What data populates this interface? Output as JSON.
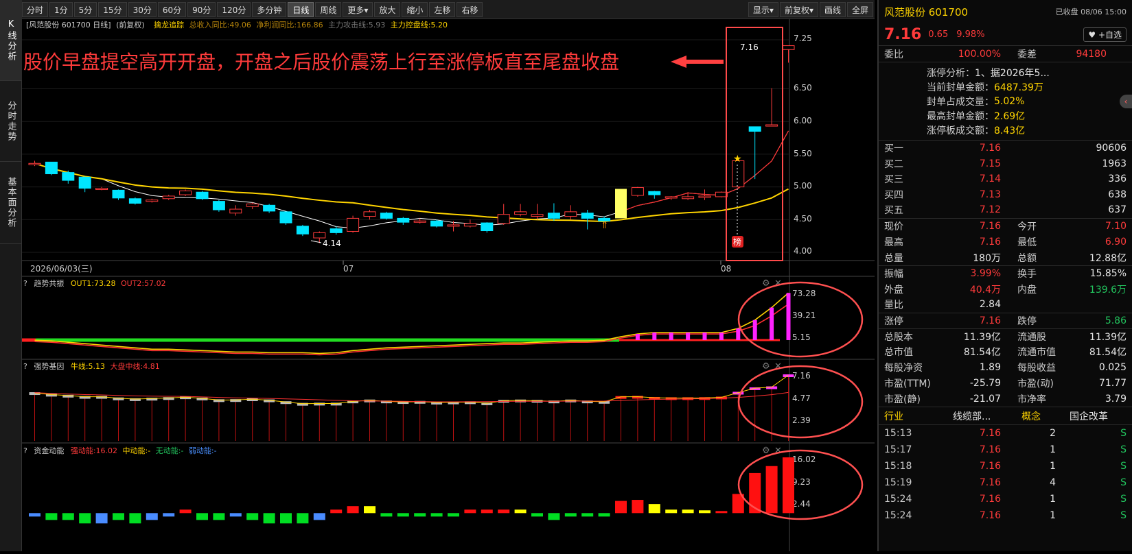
{
  "left_tabs": [
    "K线分析",
    "分时走势",
    "基本面分析"
  ],
  "toolbar": {
    "items": [
      "分时",
      "1分",
      "5分",
      "15分",
      "30分",
      "60分",
      "90分",
      "120分",
      "多分钟",
      "日线",
      "周线",
      "更多▾",
      "放大",
      "缩小",
      "左移",
      "右移"
    ],
    "right_items": [
      "显示▾",
      "前复权▾",
      "画线",
      "全屏"
    ],
    "active": "日线"
  },
  "main_info": {
    "prefix": "[风范股份 601700 日线]",
    "adjust": "(前复权)",
    "indicator": "擒龙追踪",
    "rev": "总收入同比:49.06",
    "profit": "净利润同比:166.86",
    "attack": "主力攻击线:5.93",
    "control": "主力控盘线:5.20"
  },
  "annotation": "股价早盘提空高开开盘，开盘之后股价震荡上行至涨停板直至尾盘收盘",
  "main_axis": [
    "7.25",
    "6.50",
    "6.00",
    "5.50",
    "5.00",
    "4.50",
    "4.00"
  ],
  "date_labels": [
    "2026/06/03(三)",
    "07",
    "08"
  ],
  "price_labels": {
    "high": "7.16",
    "low": "4.14",
    "bang": "榜"
  },
  "sub1": {
    "name": "趋势共振",
    "o1": "OUT1:73.28",
    "o2": "OUT2:57.02",
    "axis": [
      "73.28",
      "39.21",
      "5.15"
    ]
  },
  "sub2": {
    "name": "强势基因",
    "bull": "牛线:5.13",
    "dapan": "大盘中线:4.81",
    "axis": [
      "7.16",
      "4.77",
      "2.39"
    ]
  },
  "sub3": {
    "name": "资金动能",
    "strong": "强动能:16.02",
    "mid": "中动能:-",
    "none": "无动能:-",
    "weak": "弱动能:-",
    "axis": [
      "16.02",
      "9.23",
      "2.44"
    ]
  },
  "quote": {
    "name": "风范股份 601700",
    "status": "已收盘 08/06 15:00",
    "price": "7.16",
    "chg": "0.65",
    "pct": "9.98%",
    "watch": "+自选",
    "weibi_label": "委比",
    "weibi": "100.00%",
    "weicha_label": "委差",
    "weicha": "94180",
    "zt": [
      [
        "涨停分析：",
        "1、据2026年5..."
      ],
      [
        "当前封单金额：",
        "6487.39万"
      ],
      [
        "封单占成交量：",
        "5.02%"
      ],
      [
        "最高封单金额：",
        "2.69亿"
      ],
      [
        "涨停板成交额：",
        "8.43亿"
      ]
    ],
    "buy": [
      [
        "买一",
        "7.16",
        "90606"
      ],
      [
        "买二",
        "7.15",
        "1963"
      ],
      [
        "买三",
        "7.14",
        "336"
      ],
      [
        "买四",
        "7.13",
        "638"
      ],
      [
        "买五",
        "7.12",
        "637"
      ]
    ],
    "stats": [
      [
        "现价",
        "7.16",
        "今开",
        "7.10"
      ],
      [
        "最高",
        "7.16",
        "最低",
        "6.90"
      ],
      [
        "总量",
        "180万",
        "总额",
        "12.88亿"
      ],
      [
        "振幅",
        "3.99%",
        "换手",
        "15.85%"
      ],
      [
        "外盘",
        "40.4万",
        "内盘",
        "139.6万"
      ],
      [
        "量比",
        "2.84",
        "",
        ""
      ],
      [
        "涨停",
        "7.16",
        "跌停",
        "5.86"
      ],
      [
        "总股本",
        "11.39亿",
        "流通股",
        "11.39亿"
      ],
      [
        "总市值",
        "81.54亿",
        "流通市值",
        "81.54亿"
      ],
      [
        "每股净资",
        "1.89",
        "每股收益",
        "0.025"
      ],
      [
        "市盈(TTM)",
        "-25.79",
        "市盈(动)",
        "71.77"
      ],
      [
        "市盈(静)",
        "-21.07",
        "市净率",
        "3.79"
      ]
    ],
    "industry": [
      "行业",
      "线缆部...",
      "概念",
      "国企改革"
    ],
    "ticks": [
      [
        "15:13",
        "7.16",
        "2",
        "S"
      ],
      [
        "15:17",
        "7.16",
        "1",
        "S"
      ],
      [
        "15:18",
        "7.16",
        "1",
        "S"
      ],
      [
        "15:19",
        "7.16",
        "4",
        "S"
      ],
      [
        "15:24",
        "7.16",
        "1",
        "S"
      ],
      [
        "15:24",
        "7.16",
        "1",
        "S"
      ]
    ]
  },
  "chart_data": {
    "type": "candlestick",
    "series": [
      {
        "name": "K线",
        "values": [
          [
            5.36,
            5.36,
            5.4,
            5.32
          ],
          [
            5.38,
            5.2,
            5.38,
            5.18
          ],
          [
            5.22,
            5.1,
            5.25,
            5.05
          ],
          [
            5.15,
            4.98,
            5.16,
            4.92
          ],
          [
            4.98,
            4.98,
            5.0,
            4.95
          ],
          [
            4.95,
            4.83,
            4.96,
            4.8
          ],
          [
            4.82,
            4.75,
            4.84,
            4.73
          ],
          [
            4.78,
            4.8,
            4.82,
            4.76
          ],
          [
            4.82,
            4.86,
            4.88,
            4.8
          ],
          [
            4.88,
            4.94,
            4.96,
            4.86
          ],
          [
            4.92,
            4.82,
            4.94,
            4.8
          ],
          [
            4.78,
            4.65,
            4.8,
            4.62
          ],
          [
            4.6,
            4.66,
            4.72,
            4.56
          ],
          [
            4.7,
            4.74,
            4.76,
            4.66
          ],
          [
            4.72,
            4.63,
            4.74,
            4.6
          ],
          [
            4.62,
            4.45,
            4.62,
            4.42
          ],
          [
            4.4,
            4.28,
            4.42,
            4.25
          ],
          [
            4.22,
            4.3,
            4.32,
            4.14
          ],
          [
            4.36,
            4.3,
            4.4,
            4.27
          ],
          [
            4.32,
            4.52,
            4.56,
            4.3
          ],
          [
            4.55,
            4.62,
            4.65,
            4.5
          ],
          [
            4.6,
            4.52,
            4.62,
            4.5
          ],
          [
            4.52,
            4.46,
            4.54,
            4.42
          ],
          [
            4.46,
            4.48,
            4.52,
            4.44
          ],
          [
            4.48,
            4.4,
            4.5,
            4.38
          ],
          [
            4.4,
            4.42,
            4.48,
            4.32
          ],
          [
            4.4,
            4.44,
            4.5,
            4.38
          ],
          [
            4.45,
            4.33,
            4.46,
            4.3
          ],
          [
            4.44,
            4.58,
            4.74,
            4.42
          ],
          [
            4.58,
            4.62,
            4.74,
            4.55
          ],
          [
            4.55,
            4.58,
            4.74,
            4.5
          ],
          [
            4.6,
            4.52,
            4.75,
            4.48
          ],
          [
            4.55,
            4.62,
            4.72,
            4.5
          ],
          [
            4.6,
            4.52,
            4.65,
            4.35
          ],
          [
            4.52,
            4.48,
            4.55,
            4.46
          ],
          [
            4.52,
            4.97,
            4.97,
            4.52
          ],
          [
            4.87,
            4.99,
            5.0,
            4.85
          ],
          [
            4.93,
            4.88,
            4.94,
            4.82
          ],
          [
            4.83,
            4.85,
            4.86,
            4.8
          ],
          [
            4.82,
            4.85,
            4.92,
            4.8
          ],
          [
            4.85,
            4.86,
            4.96,
            4.8
          ],
          [
            4.85,
            4.92,
            4.93,
            4.84
          ],
          [
            5.0,
            5.4,
            5.4,
            4.98
          ],
          [
            5.92,
            5.85,
            5.92,
            5.12
          ],
          [
            5.95,
            5.95,
            6.51,
            5.95
          ],
          [
            7.1,
            7.16,
            7.16,
            6.9
          ]
        ]
      }
    ]
  }
}
